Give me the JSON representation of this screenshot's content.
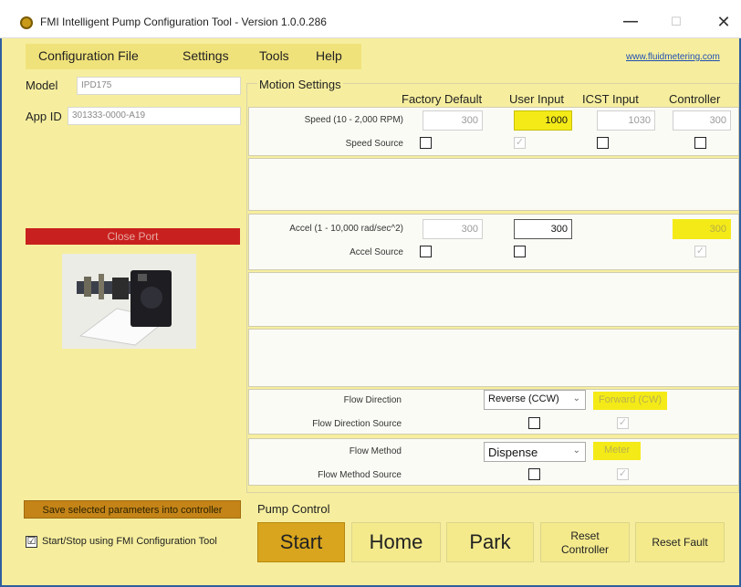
{
  "window": {
    "title": "FMI Intelligent Pump Configuration Tool - Version 1.0.0.286",
    "minimize": "—",
    "maximize": "☐",
    "close": "✕"
  },
  "menu": [
    "Configuration File",
    "Settings",
    "Tools",
    "Help"
  ],
  "website": "www.fluidmetering.com",
  "left": {
    "model_label": "Model",
    "model_value": "IPD175",
    "appid_label": "App ID",
    "appid_value": "301333-0000-A19",
    "close_port": "Close Port",
    "save_params": "Save selected parameters into controller",
    "start_stop_label": "Start/Stop using FMI Configuration Tool",
    "start_stop_checked": "☑"
  },
  "motion": {
    "title": "Motion Settings",
    "columns": [
      "Factory Default",
      "User Input",
      "ICST Input",
      "Controller"
    ],
    "speed": {
      "label": "Speed (10 - 2,000 RPM)",
      "factory": "300",
      "user": "1000",
      "icst": "1030",
      "controller": "300",
      "source_label": "Speed Source",
      "source_user_check": "✓"
    },
    "accel": {
      "label": "Accel (1 - 10,000 rad/sec^2)",
      "factory": "300",
      "user": "300",
      "controller": "300",
      "source_label": "Accel Source",
      "source_controller_check": "✓"
    },
    "flow_direction": {
      "label": "Flow Direction",
      "selected": "Reverse (CCW)",
      "controller_value": "Forward (CW)",
      "source_label": "Flow Direction Source",
      "source_controller_check": "✓"
    },
    "flow_method": {
      "label": "Flow Method",
      "selected": "Dispense",
      "controller_value": "Meter",
      "source_label": "Flow Method Source",
      "source_controller_check": "✓"
    }
  },
  "pump_control": {
    "title": "Pump Control",
    "start": "Start",
    "home": "Home",
    "park": "Park",
    "reset_controller_line1": "Reset",
    "reset_controller_line2": "Controller",
    "reset_fault": "Reset Fault"
  },
  "colors": {
    "panel_yellow": "#f6ee9e",
    "highlight_yellow": "#f4ea18",
    "close_port_red": "#c8201e",
    "start_gold": "#d9a51e",
    "window_border": "#2f5f9e"
  }
}
